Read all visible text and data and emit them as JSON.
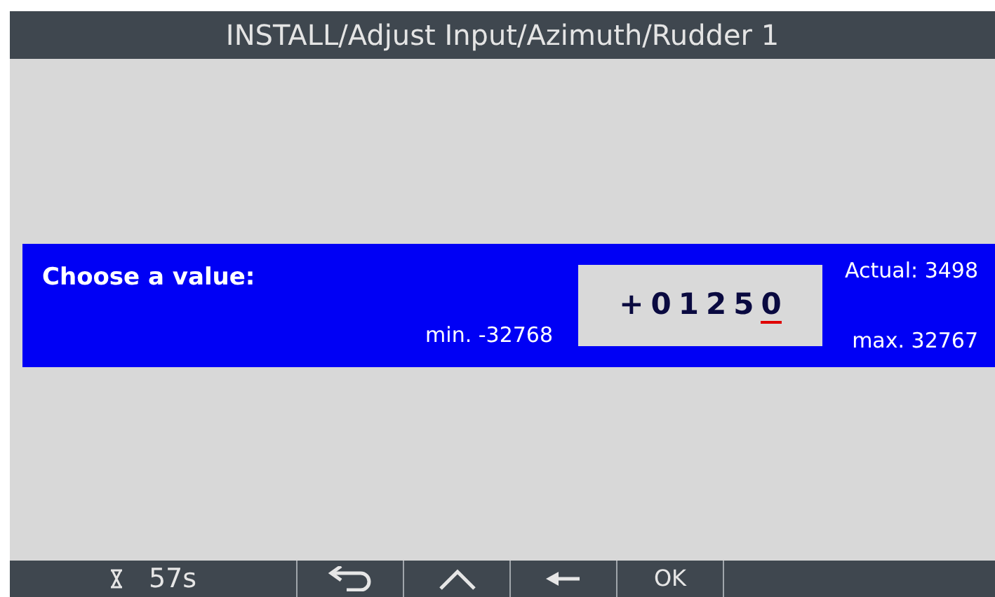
{
  "title": "INSTALL/Adjust Input/Azimuth/Rudder 1",
  "prompt": {
    "label": "Choose a value:",
    "min": "min. -32768",
    "max": "max. 32767",
    "actual": "Actual: 3498",
    "digits": [
      {
        "char": "+",
        "selected": false
      },
      {
        "char": "0",
        "selected": false
      },
      {
        "char": "1",
        "selected": false
      },
      {
        "char": "2",
        "selected": false
      },
      {
        "char": "5",
        "selected": false
      },
      {
        "char": "0",
        "selected": true
      }
    ]
  },
  "timer": "57s",
  "buttons": [
    {
      "kind": "back"
    },
    {
      "kind": "up"
    },
    {
      "kind": "left"
    },
    {
      "kind": "text",
      "label": "OK"
    }
  ]
}
